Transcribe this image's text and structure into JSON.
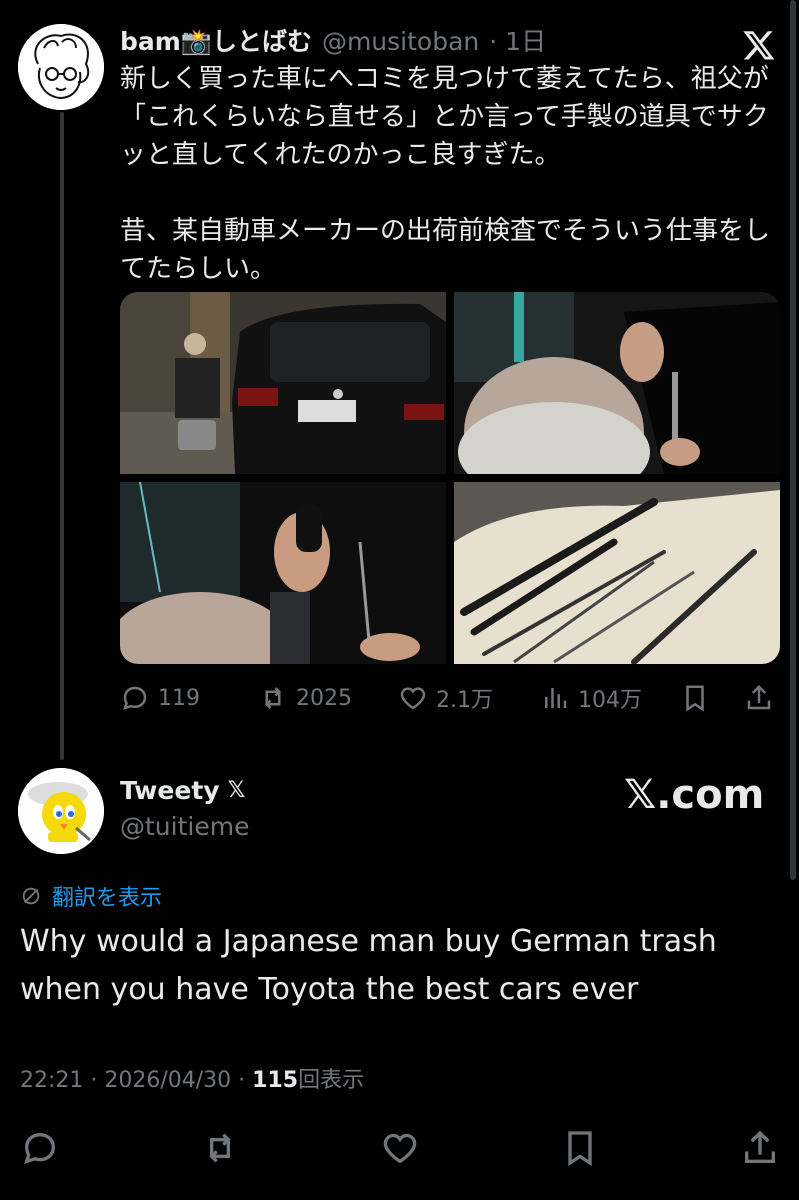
{
  "post": {
    "display_name": "bam📸しとばむ",
    "handle": "@musitoban",
    "dot_time": "· 1日",
    "text": "新しく買った車にへコミを見つけて萎えてたら、祖父が「これくらいなら直せる」とか言って手製の道具でサクッと直してくれたのかっこ良すぎた。\n\n昔、某自動車メーカーの出荷前検査でそういう仕事をしてたらしい。",
    "x_logo": "X",
    "actions": {
      "replies": "119",
      "reposts": "2025",
      "likes": "2.1万",
      "views": "104万"
    }
  },
  "reply": {
    "display_name": "Tweety",
    "x_badge": "𝕏",
    "handle": "@tuitieme",
    "brand": "𝕏.com",
    "translate_label": "翻訳を表示",
    "text": "Why would a Japanese man buy German trash when you have Toyota the best cars ever",
    "time": "22:21 · 2026/04/30 · ",
    "views_count": "115",
    "views_label": "回表示"
  },
  "colors": {
    "background": "#000000",
    "text": "#e7e9ea",
    "secondary": "#71767b",
    "link": "#1d9bf0"
  }
}
